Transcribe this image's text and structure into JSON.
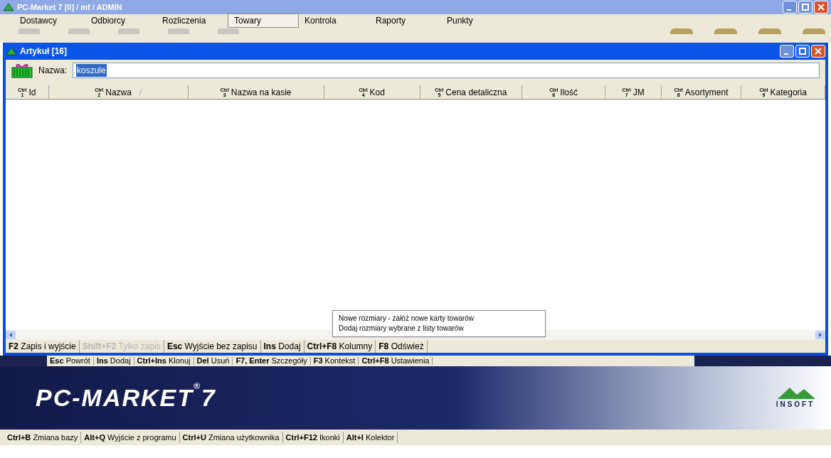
{
  "main_window": {
    "title": "PC-Market 7 [0] / mf / ADMIN"
  },
  "menu": [
    {
      "label": "Dostawcy",
      "selected": false
    },
    {
      "label": "Odbiorcy",
      "selected": false
    },
    {
      "label": "Rozliczenia",
      "selected": false
    },
    {
      "label": "Towary",
      "selected": true
    },
    {
      "label": "Kontrola",
      "selected": false
    },
    {
      "label": "Raporty",
      "selected": false
    },
    {
      "label": "Punkty",
      "selected": false
    }
  ],
  "child_window": {
    "title": "Artykuł [16]"
  },
  "search": {
    "label": "Nazwa:",
    "value": "koszule"
  },
  "table": {
    "columns": [
      {
        "ctrl": "Ctrl",
        "key": "1",
        "label": "Id"
      },
      {
        "ctrl": "Ctrl",
        "key": "2",
        "label": "Nazwa",
        "sort_mark": "/"
      },
      {
        "ctrl": "Ctrl",
        "key": "3",
        "label": "Nazwa na kasie"
      },
      {
        "ctrl": "Ctrl",
        "key": "4",
        "label": "Kod"
      },
      {
        "ctrl": "Ctrl",
        "key": "5",
        "label": "Cena detaliczna"
      },
      {
        "ctrl": "Ctrl",
        "key": "6",
        "label": "Ilość"
      },
      {
        "ctrl": "Ctrl",
        "key": "7",
        "label": "JM"
      },
      {
        "ctrl": "Ctrl",
        "key": "8",
        "label": "Asortyment"
      },
      {
        "ctrl": "Ctrl",
        "key": "9",
        "label": "Kategoria"
      }
    ]
  },
  "context_menu": [
    "Nowe rozmiary - załóż nowe karty towarów",
    "Dodaj rozmiary wybrane z listy towarów"
  ],
  "window_shortcuts": [
    {
      "key": "F2",
      "label": "Zapis i wyjście",
      "disabled": false
    },
    {
      "key": "Shift+F2",
      "label": "Tylko zapis",
      "disabled": true
    },
    {
      "key": "Esc",
      "label": "Wyjście bez zapisu",
      "disabled": false
    },
    {
      "key": "Ins",
      "label": "Dodaj",
      "disabled": false
    },
    {
      "key": "Ctrl+F8",
      "label": "Kolumny",
      "disabled": false
    },
    {
      "key": "F8",
      "label": "Odśwież",
      "disabled": false
    }
  ],
  "background_shortcuts": [
    {
      "key": "Esc",
      "label": "Powrót"
    },
    {
      "key": "Ins",
      "label": "Dodaj"
    },
    {
      "key": "Ctrl+Ins",
      "label": "Klonuj"
    },
    {
      "key": "Del",
      "label": "Usuń"
    },
    {
      "key": "F7, Enter",
      "label": "Szczegóły"
    },
    {
      "key": "F3",
      "label": "Kontekst"
    },
    {
      "key": "Ctrl+F8",
      "label": "Ustawienia"
    }
  ],
  "banner": {
    "logo": "PC-MARKET",
    "logo_mark": "®",
    "logo_version": "7",
    "vendor": "INSOFT"
  },
  "status_bar": [
    {
      "key": "Ctrl+B",
      "label": "Zmiana bazy"
    },
    {
      "key": "Alt+Q",
      "label": "Wyjście z programu"
    },
    {
      "key": "Ctrl+U",
      "label": "Zmiana użytkownika"
    },
    {
      "key": "Ctrl+F12",
      "label": "Ikonki"
    },
    {
      "key": "Alt+I",
      "label": "Kolektor"
    }
  ]
}
